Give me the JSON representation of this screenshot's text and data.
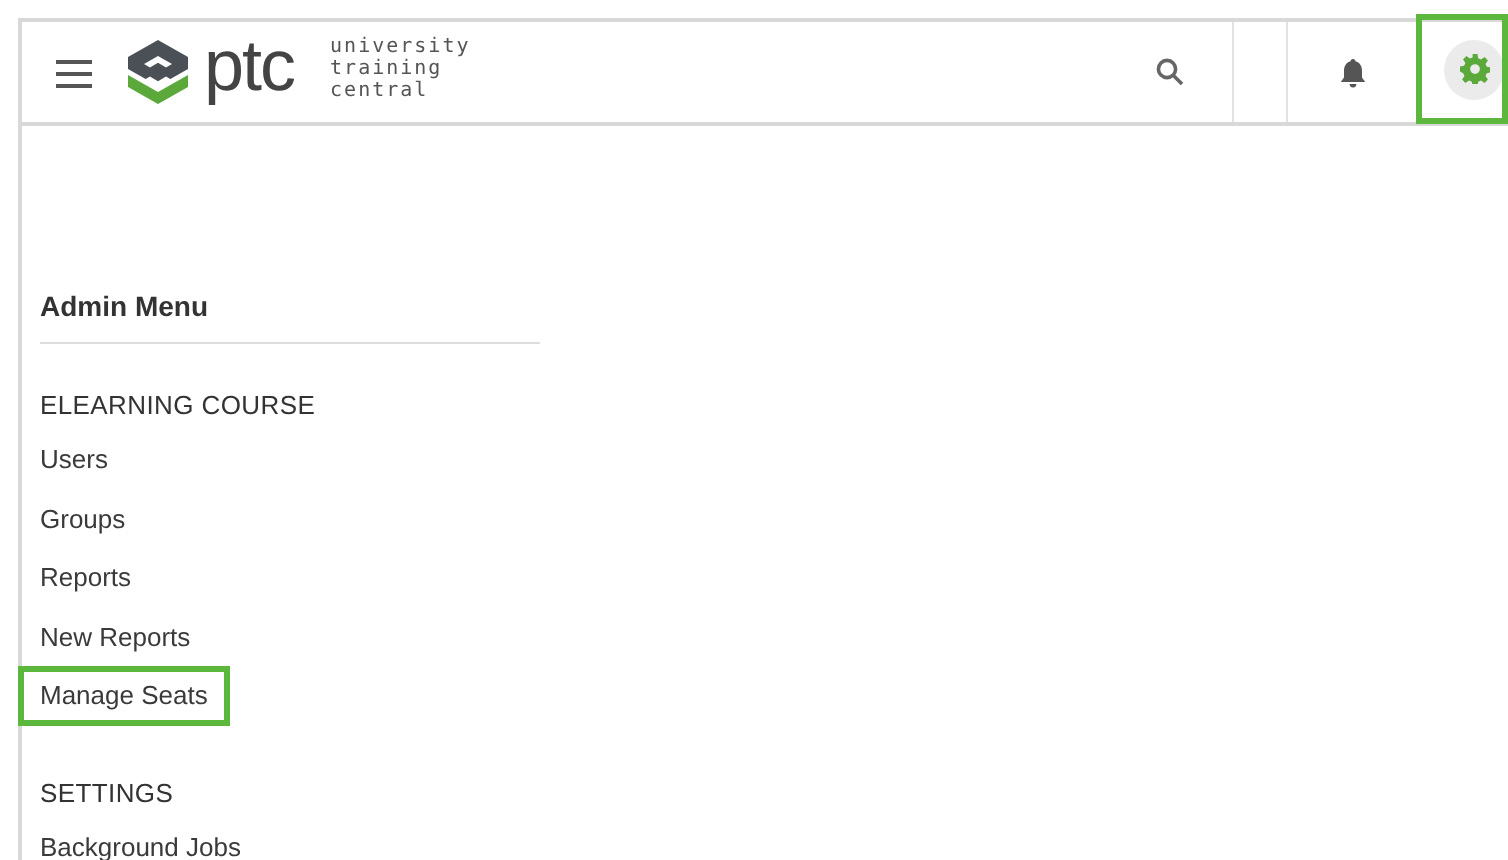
{
  "header": {
    "logo": {
      "wordmark": "ptc",
      "tagline": [
        "university",
        "training",
        "central"
      ]
    },
    "actions": [
      {
        "kind": "search",
        "selected": false,
        "highlighted": false
      },
      {
        "kind": "notifications",
        "selected": false,
        "highlighted": false
      },
      {
        "kind": "settings",
        "selected": true,
        "highlighted": true
      }
    ]
  },
  "menu": {
    "title": "Admin Menu",
    "sections": [
      {
        "heading": "ELEARNING COURSE",
        "items": [
          {
            "label": "Users",
            "highlighted": false
          },
          {
            "label": "Groups",
            "highlighted": false
          },
          {
            "label": "Reports",
            "highlighted": false
          },
          {
            "label": "New Reports",
            "highlighted": false
          },
          {
            "label": "Manage Seats",
            "highlighted": true
          }
        ]
      },
      {
        "heading": "SETTINGS",
        "items": [
          {
            "label": "Background Jobs",
            "highlighted": false
          }
        ]
      }
    ]
  }
}
